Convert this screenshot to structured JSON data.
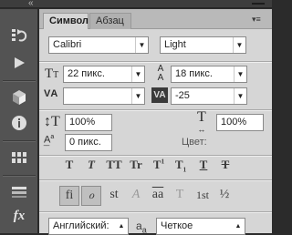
{
  "tabs": [
    {
      "label": "Символ"
    },
    {
      "label": "Абзац"
    }
  ],
  "font": {
    "family": "Calibri",
    "style": "Light",
    "size": "22 пикс.",
    "leading": "18 пикс.",
    "kerning": "",
    "tracking": "-25",
    "vertical_scale": "100%",
    "horizontal_scale": "100%",
    "baseline_shift": "0 пикс.",
    "color_label": "Цвет:"
  },
  "type_style_buttons": [
    "T",
    "T",
    "TT",
    "Tr",
    "T",
    "T",
    "T",
    "T"
  ],
  "type_style_superscripts": [
    "",
    "",
    "",
    "",
    "1",
    "",
    "",
    ""
  ],
  "type_style_subscripts": [
    "",
    "",
    "",
    "",
    "",
    "1",
    "",
    ""
  ],
  "opentype_buttons": [
    "fi",
    "ℴ",
    "st",
    "A",
    "aa",
    "T",
    "1st",
    "½"
  ],
  "bottom": {
    "language": "Английский:",
    "aa_label": "a",
    "aa_sub": "a",
    "antialias": "Четкое"
  },
  "colors": {
    "panel_bg": "#d6d6d6",
    "dock_bg": "#535353",
    "tab_bar": "#b9b9b9"
  }
}
